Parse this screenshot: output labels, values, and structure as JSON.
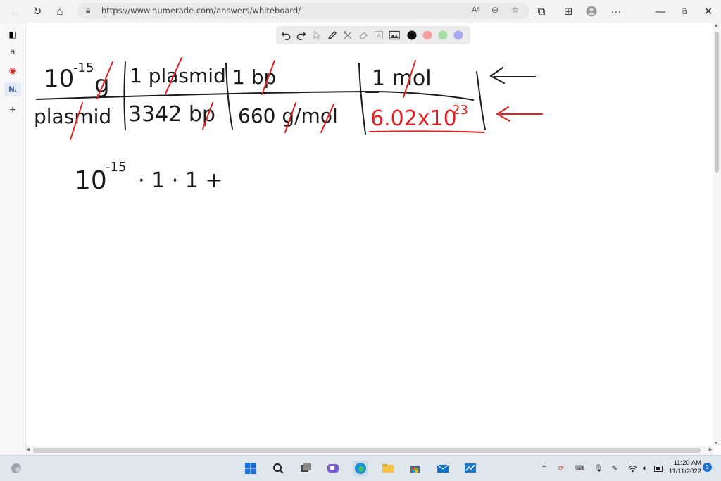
{
  "browser": {
    "url": "https://www.numerade.com/answers/whiteboard/",
    "address_icons": [
      "read-aloud-icon",
      "zoom-icon",
      "favorites-icon"
    ],
    "toolbar_icons": [
      "extensions-icon",
      "collections-icon",
      "profile-icon",
      "more-icon"
    ],
    "window_controls": [
      "minimize-icon",
      "restore-icon",
      "close-icon"
    ]
  },
  "sidebar": {
    "items": [
      {
        "name": "tab-actions",
        "glyph": "◧"
      },
      {
        "name": "amazon",
        "glyph": "a"
      },
      {
        "name": "record",
        "glyph": "◉"
      },
      {
        "name": "numerade",
        "glyph": "N."
      },
      {
        "name": "add",
        "glyph": "+"
      }
    ]
  },
  "whiteboard": {
    "tools": [
      "undo-icon",
      "redo-icon",
      "pointer-icon",
      "pen-icon",
      "tools-icon",
      "eraser-icon",
      "text-icon",
      "image-icon"
    ],
    "colors": [
      "#111111",
      "#f4a0a0",
      "#a6dca6",
      "#a8a8f0"
    ],
    "handwriting": {
      "row1": {
        "c1_base": "10",
        "c1_exp": "-15",
        "c1_unit": "g",
        "c2": "1 plasmid",
        "c3": "1 bp",
        "c4": "1 mol"
      },
      "row2": {
        "c1": "plasmid",
        "c2": "3342 bp",
        "c3": "660 g/mol",
        "c4_base": "6.02x10",
        "c4_exp": "23"
      },
      "expr": {
        "base": "10",
        "exp": "-15",
        "rest": "· 1  · 1 +"
      }
    },
    "ink": "#1a1a1a",
    "accent": "#e02020"
  },
  "taskbar": {
    "time": "11:20 AM",
    "date": "11/11/2022",
    "notification_count": "2"
  }
}
